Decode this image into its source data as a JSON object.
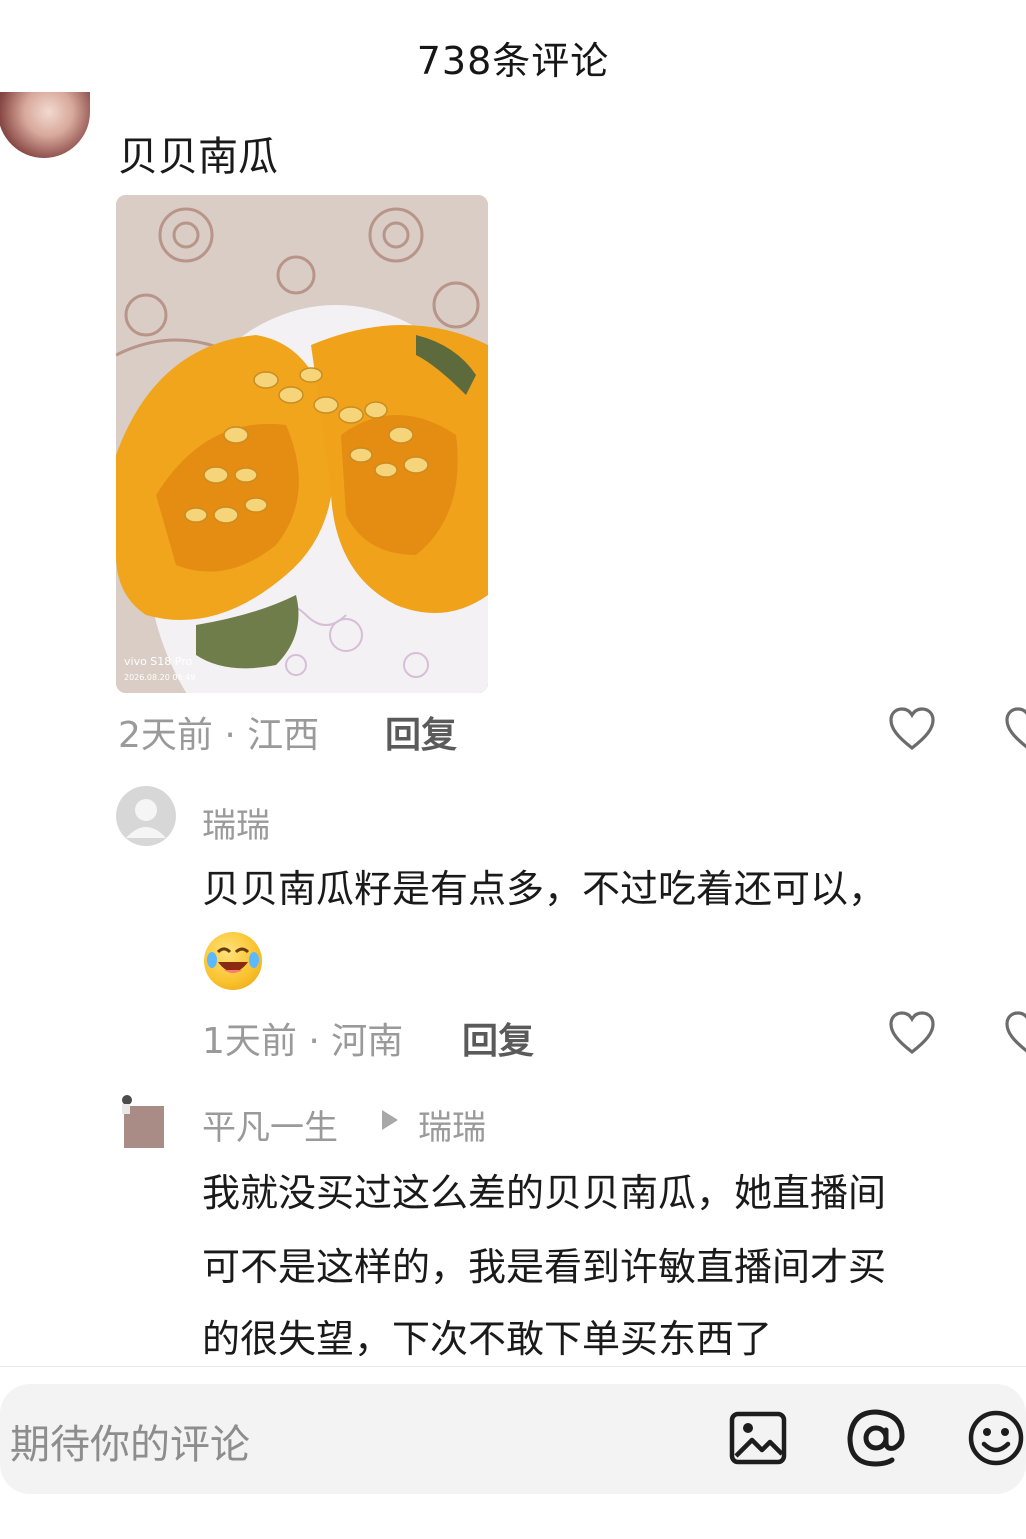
{
  "header": {
    "title": "738条评论"
  },
  "main_comment": {
    "text": "贝贝南瓜",
    "image_watermark_model": "vivo S18 Pro",
    "image_watermark_time": "2026.08.20 06:49",
    "meta": "2天前 · 江西",
    "reply_label": "回复"
  },
  "replies": [
    {
      "username": "瑞瑞",
      "text": "贝贝南瓜籽是有点多，不过吃着还可以，",
      "emoji": "laughing-crying-emoji",
      "meta": "1天前 · 河南",
      "reply_label": "回复"
    },
    {
      "username": "平凡一生",
      "reply_to": "瑞瑞",
      "lines": [
        "我就没买过这么差的贝贝南瓜，她直播间",
        "可不是这样的，我是看到许敏直播间才买",
        "的很失望，下次不敢下单买东西了"
      ]
    }
  ],
  "input": {
    "placeholder": "期待你的评论"
  },
  "icons": [
    "image-icon",
    "at-icon",
    "emoji-icon",
    "heart-icon"
  ],
  "colors": {
    "pumpkin": "#f0a21b",
    "meta_gray": "#9a9a9a",
    "bar_bg": "#f3f3f3"
  }
}
